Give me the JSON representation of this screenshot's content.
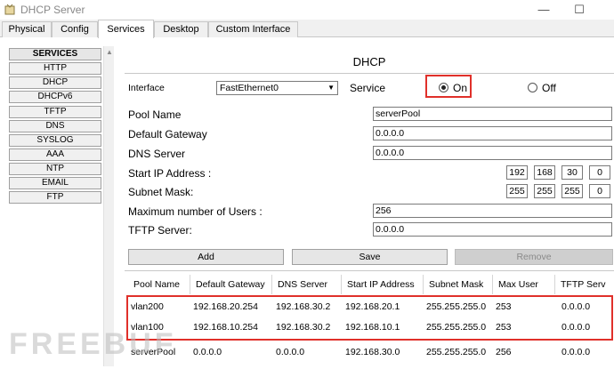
{
  "window": {
    "title": "DHCP  Server",
    "minimize_glyph": "—",
    "maximize_glyph": "☐"
  },
  "tabs": [
    "Physical",
    "Config",
    "Services",
    "Desktop",
    "Custom Interface"
  ],
  "active_tab": "Services",
  "sidebar": {
    "header": "SERVICES",
    "items": [
      "HTTP",
      "DHCP",
      "DHCPv6",
      "TFTP",
      "DNS",
      "SYSLOG",
      "AAA",
      "NTP",
      "EMAIL",
      "FTP"
    ]
  },
  "dhcp": {
    "title": "DHCP",
    "interface_label": "Interface",
    "interface_value": "FastEthernet0",
    "service_label": "Service",
    "on_label": "On",
    "off_label": "Off",
    "service_state": "On",
    "fields": {
      "pool_name": {
        "label": "Pool Name",
        "value": "serverPool"
      },
      "default_gateway": {
        "label": "Default Gateway",
        "value": "0.0.0.0"
      },
      "dns_server": {
        "label": "DNS Server",
        "value": "0.0.0.0"
      },
      "start_ip": {
        "label": "Start IP Address :",
        "octets": [
          "192",
          "168",
          "30",
          "0"
        ]
      },
      "subnet_mask": {
        "label": "Subnet Mask:",
        "octets": [
          "255",
          "255",
          "255",
          "0"
        ]
      },
      "max_users": {
        "label": "Maximum number of Users :",
        "value": "256"
      },
      "tftp_server": {
        "label": "TFTP Server:",
        "value": "0.0.0.0"
      }
    },
    "buttons": {
      "add": "Add",
      "save": "Save",
      "remove": "Remove"
    },
    "table": {
      "columns": [
        "Pool Name",
        "Default Gateway",
        "DNS Server",
        "Start IP Address",
        "Subnet Mask",
        "Max User",
        "TFTP Serv"
      ],
      "rows": [
        [
          "vlan200",
          "192.168.20.254",
          "192.168.30.2",
          "192.168.20.1",
          "255.255.255.0",
          "253",
          "0.0.0.0"
        ],
        [
          "vlan100",
          "192.168.10.254",
          "192.168.30.2",
          "192.168.10.1",
          "255.255.255.0",
          "253",
          "0.0.0.0"
        ],
        [
          "serverPool",
          "0.0.0.0",
          "0.0.0.0",
          "192.168.30.0",
          "255.255.255.0",
          "256",
          "0.0.0.0"
        ]
      ]
    }
  },
  "watermark": "FREEBUF",
  "colors": {
    "highlight_red": "#e0302a",
    "watermark_gray": "#bcbcbc"
  }
}
